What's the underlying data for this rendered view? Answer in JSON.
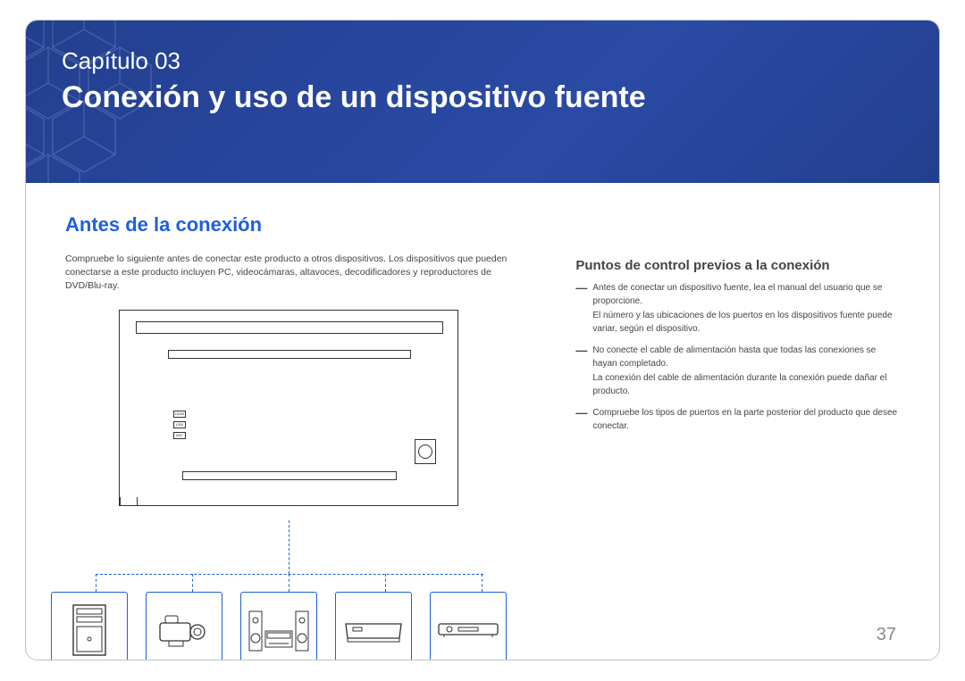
{
  "chapter": {
    "label": "Capítulo 03",
    "title": "Conexión y uso de un dispositivo fuente"
  },
  "section": {
    "heading": "Antes de la conexión",
    "intro": "Compruebe lo siguiente antes de conectar este producto a otros dispositivos. Los dispositivos que pueden conectarse a este producto incluyen PC, videocámaras, altavoces, decodificadores y reproductores de DVD/Blu-ray."
  },
  "right": {
    "subHeading": "Puntos de control previos a la conexión",
    "items": [
      {
        "main": "Antes de conectar un dispositivo fuente, lea el manual del usuario que se proporcione.",
        "sub": "El número y las ubicaciones de los puertos en los dispositivos fuente puede variar, según el dispositivo."
      },
      {
        "main": "No conecte el cable de alimentación hasta que todas las conexiones se hayan completado.",
        "sub": "La conexión del cable de alimentación durante la conexión puede dañar el producto."
      },
      {
        "main": "Compruebe los tipos de puertos en la parte posterior del producto que desee conectar.",
        "sub": ""
      }
    ]
  },
  "diagram": {
    "tv_ports": [
      "HDMI",
      "USB",
      "ANT"
    ],
    "devices": [
      "pc-tower",
      "camcorder",
      "stereo-speakers",
      "set-top-box",
      "dvd-player"
    ]
  },
  "page_number": "37",
  "colors": {
    "banner": "#233f8f",
    "accent_blue": "#1f5fdc"
  }
}
